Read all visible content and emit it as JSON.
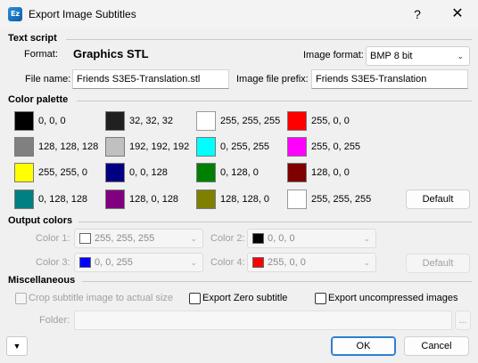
{
  "window": {
    "title": "Export Image Subtitles",
    "app_icon": "Ez",
    "help_label": "?",
    "close_label": "✕"
  },
  "text_script": {
    "heading": "Text script",
    "format_label": "Format:",
    "format_value": "Graphics STL",
    "image_format_label": "Image format:",
    "image_format_value": "BMP 8 bit",
    "file_name_label": "File name:",
    "file_name_value": "Friends S3E5-Translation.stl",
    "image_prefix_label": "Image file prefix:",
    "image_prefix_value": "Friends S3E5-Translation"
  },
  "palette": {
    "heading": "Color palette",
    "default_label": "Default",
    "swatches": [
      {
        "color": "#000000",
        "label": "0, 0, 0"
      },
      {
        "color": "#202020",
        "label": "32, 32, 32"
      },
      {
        "color": "#ffffff",
        "label": "255, 255, 255"
      },
      {
        "color": "#ff0000",
        "label": "255, 0, 0"
      },
      {
        "color": "#808080",
        "label": "128, 128, 128"
      },
      {
        "color": "#c0c0c0",
        "label": "192, 192, 192"
      },
      {
        "color": "#00ffff",
        "label": "0, 255, 255"
      },
      {
        "color": "#ff00ff",
        "label": "255, 0, 255"
      },
      {
        "color": "#ffff00",
        "label": "255, 255, 0"
      },
      {
        "color": "#000080",
        "label": "0, 0, 128"
      },
      {
        "color": "#008000",
        "label": "0, 128, 0"
      },
      {
        "color": "#800000",
        "label": "128, 0, 0"
      },
      {
        "color": "#008080",
        "label": "0, 128, 128"
      },
      {
        "color": "#800080",
        "label": "128, 0, 128"
      },
      {
        "color": "#808000",
        "label": "128, 128, 0"
      },
      {
        "color": "#ffffff",
        "label": "255, 255, 255"
      }
    ]
  },
  "output_colors": {
    "heading": "Output colors",
    "default_label": "Default",
    "color1_label": "Color 1:",
    "color1_swatch": "#ffffff",
    "color1_value": "255, 255, 255",
    "color2_label": "Color 2:",
    "color2_swatch": "#000000",
    "color2_value": "0, 0, 0",
    "color3_label": "Color 3:",
    "color3_swatch": "#0000ff",
    "color3_value": "0, 0, 255",
    "color4_label": "Color 4:",
    "color4_swatch": "#ff0000",
    "color4_value": "255, 0, 0"
  },
  "misc": {
    "heading": "Miscellaneous",
    "crop_label": "Crop subtitle image to actual size",
    "zero_label": "Export Zero subtitle",
    "uncompressed_label": "Export uncompressed images",
    "folder_label": "Folder:",
    "folder_value": "",
    "browse_label": "..."
  },
  "footer": {
    "ok_label": "OK",
    "cancel_label": "Cancel"
  }
}
